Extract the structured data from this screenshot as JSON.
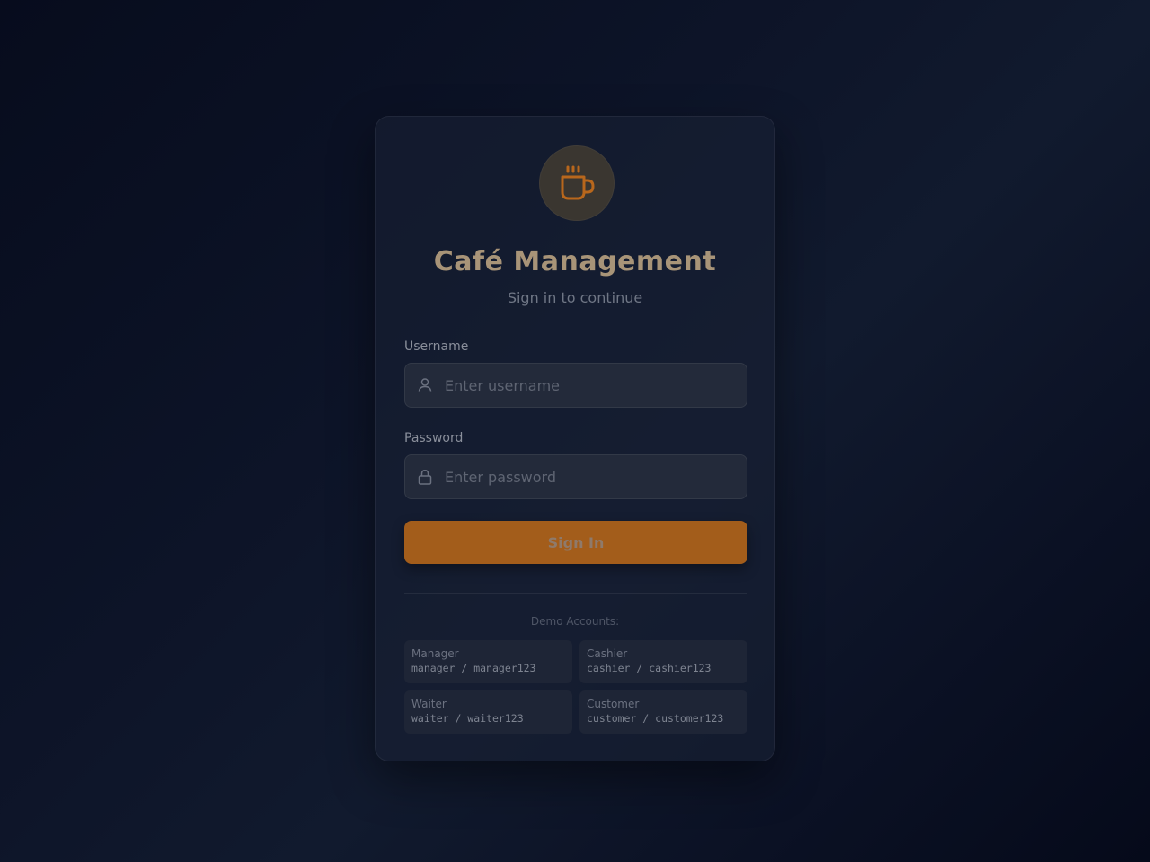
{
  "app": {
    "title": "Café Management",
    "subtitle": "Sign in to continue",
    "logo_icon": "coffee-cup-icon",
    "accent_color": "#a35d1b"
  },
  "form": {
    "username_label": "Username",
    "username_placeholder": "Enter username",
    "username_icon": "user-icon",
    "password_label": "Password",
    "password_placeholder": "Enter password",
    "password_icon": "lock-icon",
    "submit_label": "Sign In"
  },
  "demo": {
    "heading": "Demo Accounts:",
    "accounts": [
      {
        "role": "Manager",
        "credentials": "manager / manager123"
      },
      {
        "role": "Cashier",
        "credentials": "cashier / cashier123"
      },
      {
        "role": "Waiter",
        "credentials": "waiter / waiter123"
      },
      {
        "role": "Customer",
        "credentials": "customer / customer123"
      }
    ]
  }
}
